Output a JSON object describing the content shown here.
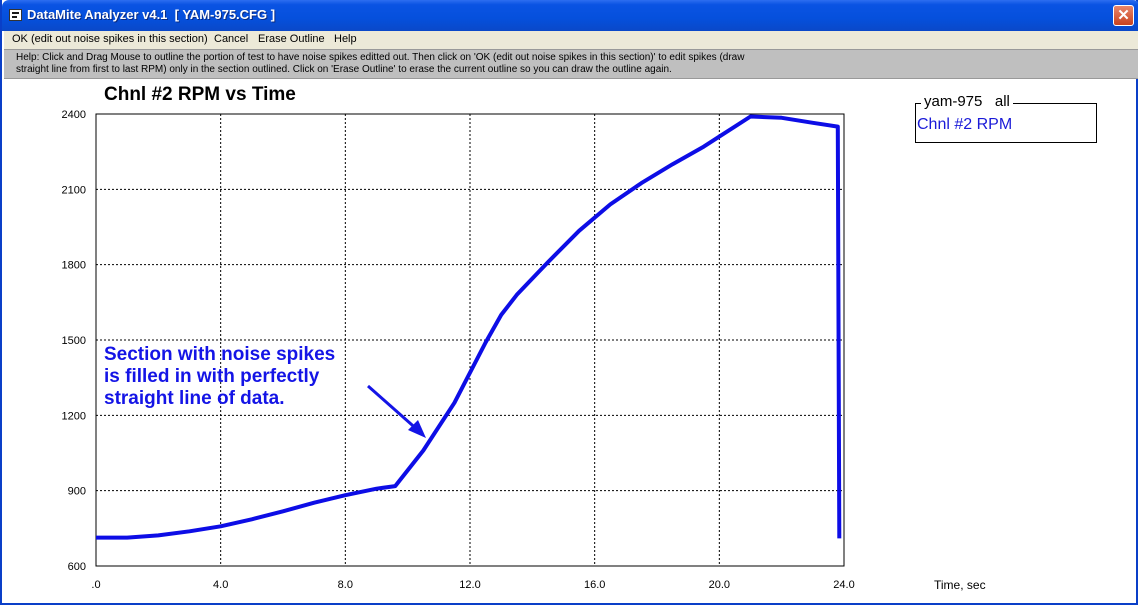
{
  "window": {
    "title": "DataMite Analyzer v4.1  [ YAM-975.CFG ]",
    "close_glyph": "✕"
  },
  "menu": {
    "items": [
      "OK (edit out noise spikes in this section)",
      "Cancel",
      "Erase Outline",
      "Help"
    ]
  },
  "help": {
    "line1": "Help:  Click and Drag Mouse to outline the portion of test to have noise spikes editted out.  Then click on 'OK (edit out noise spikes in this section)' to edit spikes (draw",
    "line2": "straight line from first to last RPM) only in the section outlined.  Click on 'Erase Outline' to erase the current outline so you can draw the outline again."
  },
  "legend": {
    "title": "yam-975   all",
    "entry": "Chnl #2 RPM"
  },
  "annotation": {
    "lines": [
      "Section with noise spikes",
      "is filled in with perfectly",
      "straight line of data."
    ]
  },
  "colors": {
    "series": "#0d0de6",
    "annotation": "#1414e6",
    "titlebar": "#0a53e3"
  },
  "chart_data": {
    "type": "line",
    "title": "Chnl #2 RPM vs Time",
    "xlabel": "Time, sec",
    "ylabel": "",
    "xlim": [
      0,
      24
    ],
    "ylim": [
      600,
      2400
    ],
    "x_ticks": [
      ".0",
      "4.0",
      "8.0",
      "12.0",
      "16.0",
      "20.0",
      "24.0"
    ],
    "y_ticks": [
      "2400",
      "2100",
      "1800",
      "1500",
      "1200",
      "900",
      "600"
    ],
    "grid": true,
    "legend_position": "top-right",
    "series": [
      {
        "name": "Chnl #2 RPM",
        "x": [
          0,
          1,
          2,
          3,
          4,
          5,
          6,
          7,
          8,
          9,
          9.6,
          10.5,
          11.5,
          12.5,
          13.0,
          13.5,
          14.5,
          15.5,
          16.5,
          17.5,
          18.5,
          19.5,
          20.0,
          21.0,
          22.0,
          23.0,
          23.8,
          23.85
        ],
        "y": [
          713,
          713,
          722,
          738,
          758,
          786,
          818,
          852,
          882,
          908,
          918,
          1060,
          1250,
          1490,
          1600,
          1680,
          1810,
          1935,
          2040,
          2125,
          2200,
          2270,
          2310,
          2390,
          2385,
          2365,
          2350,
          710
        ]
      }
    ]
  }
}
